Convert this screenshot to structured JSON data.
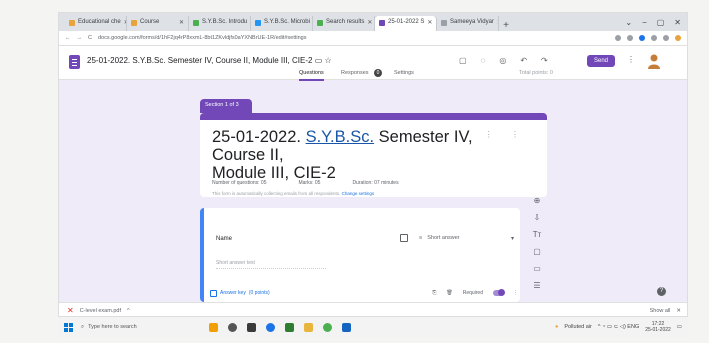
{
  "browser": {
    "tabs": [
      {
        "label": "Educational che",
        "color": "#e8a33d",
        "active": false
      },
      {
        "label": "Course",
        "color": "#e8a33d",
        "active": false
      },
      {
        "label": "S.Y.B.Sc. Introdu",
        "color": "#4caf50",
        "active": false
      },
      {
        "label": "S.Y.B.Sc. Microbi",
        "color": "#2196f3",
        "active": false
      },
      {
        "label": "Search results",
        "color": "#4caf50",
        "active": false
      },
      {
        "label": "25-01-2022 S",
        "color": "#7248b9",
        "active": true
      },
      {
        "label": "Sameeya Vidyar",
        "color": "#9aa0a6",
        "active": false
      }
    ],
    "new_tab": "+",
    "window_controls": [
      "⌄",
      "−",
      "▢",
      "✕"
    ],
    "address": {
      "back": "←",
      "forward": "→",
      "reload": "C",
      "url": "docs.google.com/forms/d/1hF2jq4rP8xxmL-8bt1ZKvldjfs0aYXNBrUE-1R/edit#settings"
    }
  },
  "forms": {
    "title": "25-01-2022. S.Y.B.Sc. Semester IV, Course II, Module III, CIE-2",
    "folder_icon": "folder-icon",
    "star_icon": "star-icon",
    "header_icons": [
      "▢",
      "◌",
      "◎",
      "↶",
      "↷"
    ],
    "send_label": "Send",
    "more": "⋮",
    "tabs": {
      "questions": "Questions",
      "responses": "Responses",
      "responses_count": "0",
      "settings": "Settings"
    },
    "total_points": "Total points: 0"
  },
  "section": {
    "label": "Section 1 of 3"
  },
  "title_card": {
    "date": "25-01-2022.",
    "course_code": "S.Y.B.Sc.",
    "rest_line1": "Semester IV, Course II,",
    "line2": "Module III, CIE-2",
    "menu": "⋮ ⋮",
    "questions_meta": "Number of questions: 05",
    "marks_meta": "Marks: 05",
    "duration_meta": "Duration: 07 minutes",
    "description": "This form is automatically collecting emails from all respondents.",
    "change_settings": "Change settings"
  },
  "side_tools": [
    "⊕",
    "⇩",
    "Tт",
    "▢",
    "▭",
    "☰"
  ],
  "question": {
    "label": "Name",
    "type": "Short answer",
    "type_icon": "≡",
    "answer_placeholder": "Short answer text",
    "answer_key": "Answer key",
    "points": "(0 points)",
    "copy_icon": "⎘",
    "delete_icon": "🗑",
    "required_label": "Required",
    "more": "⋮"
  },
  "help": "?",
  "download_bar": {
    "file": "C-level exam.pdf",
    "chevron": "^",
    "show_all": "Show all",
    "close": "✕"
  },
  "taskbar": {
    "search_placeholder": "Type here to search",
    "apps": [
      "#f29f05",
      "#555",
      "#3a3a3a",
      "#1a73e8",
      "#2e7d32",
      "#4caf50",
      "#1a73e8",
      "#1565c0"
    ],
    "weather": "Polluted air",
    "tray_icons": "^ ◔ ▭ ⊂ ◁) ENG",
    "time": "17:22",
    "date": "25-01-2022"
  }
}
